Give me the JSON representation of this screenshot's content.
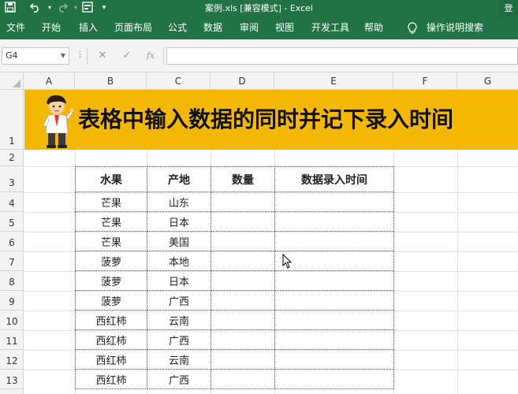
{
  "titlebar": {
    "title": "案例.xls  [兼容模式]  -  Excel",
    "login": "登"
  },
  "ribbon": {
    "tabs": [
      "文件",
      "开始",
      "插入",
      "页面布局",
      "公式",
      "数据",
      "审阅",
      "视图",
      "开发工具",
      "帮助"
    ],
    "tellme": "操作说明搜索"
  },
  "formula_bar": {
    "name_box": "G4",
    "fx": "fx",
    "cancel": "✕",
    "enter": "✓",
    "value": ""
  },
  "columns": [
    "A",
    "B",
    "C",
    "D",
    "E",
    "F",
    "G"
  ],
  "rows": [
    "1",
    "2",
    "3",
    "4",
    "5",
    "6",
    "7",
    "8",
    "9",
    "10",
    "11",
    "12",
    "13"
  ],
  "banner": {
    "title": "表格中输入数据的同时并记下录入时间",
    "color": "#f5b800"
  },
  "table": {
    "headers": [
      "水果",
      "产地",
      "数量",
      "数据录入时间"
    ],
    "rows": [
      [
        "芒果",
        "山东",
        "",
        ""
      ],
      [
        "芒果",
        "日本",
        "",
        ""
      ],
      [
        "芒果",
        "美国",
        "",
        ""
      ],
      [
        "菠萝",
        "本地",
        "",
        ""
      ],
      [
        "菠萝",
        "日本",
        "",
        ""
      ],
      [
        "菠萝",
        "广西",
        "",
        ""
      ],
      [
        "西红柿",
        "云南",
        "",
        ""
      ],
      [
        "西红柿",
        "广西",
        "",
        ""
      ],
      [
        "西红柿",
        "云南",
        "",
        ""
      ],
      [
        "西红柿",
        "广西",
        "",
        ""
      ]
    ]
  },
  "colors": {
    "excel_green": "#217346",
    "banner_yellow": "#f5b800"
  }
}
